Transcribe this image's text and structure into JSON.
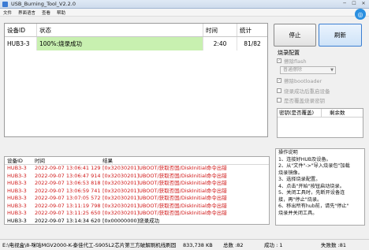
{
  "window": {
    "title": "USB_Burning_Tool_V2.2.0"
  },
  "menu": [
    "文件",
    "界面语言",
    "查看",
    "帮助"
  ],
  "logo_glyph": "◎",
  "device_table": {
    "headers": [
      "设备ID",
      "状态",
      "时间",
      "统计"
    ],
    "rows": [
      {
        "id": "HUB3-3",
        "status": "100%:烧录成功",
        "time": "2:40",
        "stats": "81/82"
      }
    ]
  },
  "buttons": {
    "stop": "停止",
    "refresh": "刷新"
  },
  "config": {
    "title": "烧录配置",
    "erase_flash": "擦除flash",
    "erase_mode": "普通擦除",
    "erase_bootloader": "擦除bootloader",
    "reset_after_success": "烧录成功后重启设备",
    "overwrite_key": "是否覆盖烧录密钥"
  },
  "key_table": {
    "col1": "密钥(是否覆盖)",
    "col2": "剩余数"
  },
  "log": {
    "headers": [
      "设备ID",
      "时间",
      "结果"
    ],
    "rows": [
      {
        "id": "HUB3-3",
        "time": "2022-09-07 13:06:41 129",
        "result": "[0x32030201]UBOOT/获取否固/DiskInitial命令出错",
        "ok": false
      },
      {
        "id": "HUB3-3",
        "time": "2022-09-07 13:06:47 914",
        "result": "[0x32030201]UBOOT/获取否固/DiskInitial命令出错",
        "ok": false
      },
      {
        "id": "HUB3-3",
        "time": "2022-09-07 13:06:53 818",
        "result": "[0x32030201]UBOOT/获取否固/DiskInitial命令出错",
        "ok": false
      },
      {
        "id": "HUB3-3",
        "time": "2022-09-07 13:06:59 741",
        "result": "[0x32030201]UBOOT/获取否固/DiskInitial命令出错",
        "ok": false
      },
      {
        "id": "HUB3-3",
        "time": "2022-09-07 13:07:05 572",
        "result": "[0x32030201]UBOOT/获取否固/DiskInitial命令出错",
        "ok": false
      },
      {
        "id": "HUB3-3",
        "time": "2022-09-07 13:11:19 798",
        "result": "[0x32030201]UBOOT/获取否固/DiskInitial命令出错",
        "ok": false
      },
      {
        "id": "HUB3-3",
        "time": "2022-09-07 13:11:25 650",
        "result": "[0x32030201]UBOOT/获取否固/DiskInitial命令出错",
        "ok": false
      },
      {
        "id": "HUB3-3",
        "time": "2022-09-07 13:14:34 620",
        "result": "[0x00000000]烧录成功",
        "ok": true
      }
    ]
  },
  "instructions": {
    "title": "操作说明",
    "lines": [
      "1、连接好HUB及设备。",
      "2、从\"文件\"->\"导入烧录包\"加载",
      "    烧录镜像。",
      "3、选择烧录配置。",
      "4、点击\"开始\"按钮启动烧录。",
      "5、关闭工具时，先断开设备连",
      "    接，再\"停止\"烧录。",
      "6、移出所有hub前，请先\"停止\"",
      "    烧录并关闭工具。"
    ]
  },
  "status_bar": {
    "path": "E:\\电视盒\\8-咪咕MGV2000-K-泰佳代工-S905L2芯片第三方破解刷机线刷固",
    "size": "833,738 KB",
    "total_label": "总数 :82",
    "success_label": "成功 : 1",
    "fail_label": "失败数 :81"
  },
  "colors": {
    "success_bg": "#c8f0b0",
    "error_text": "#d01818",
    "accent": "#3c7fd2"
  }
}
